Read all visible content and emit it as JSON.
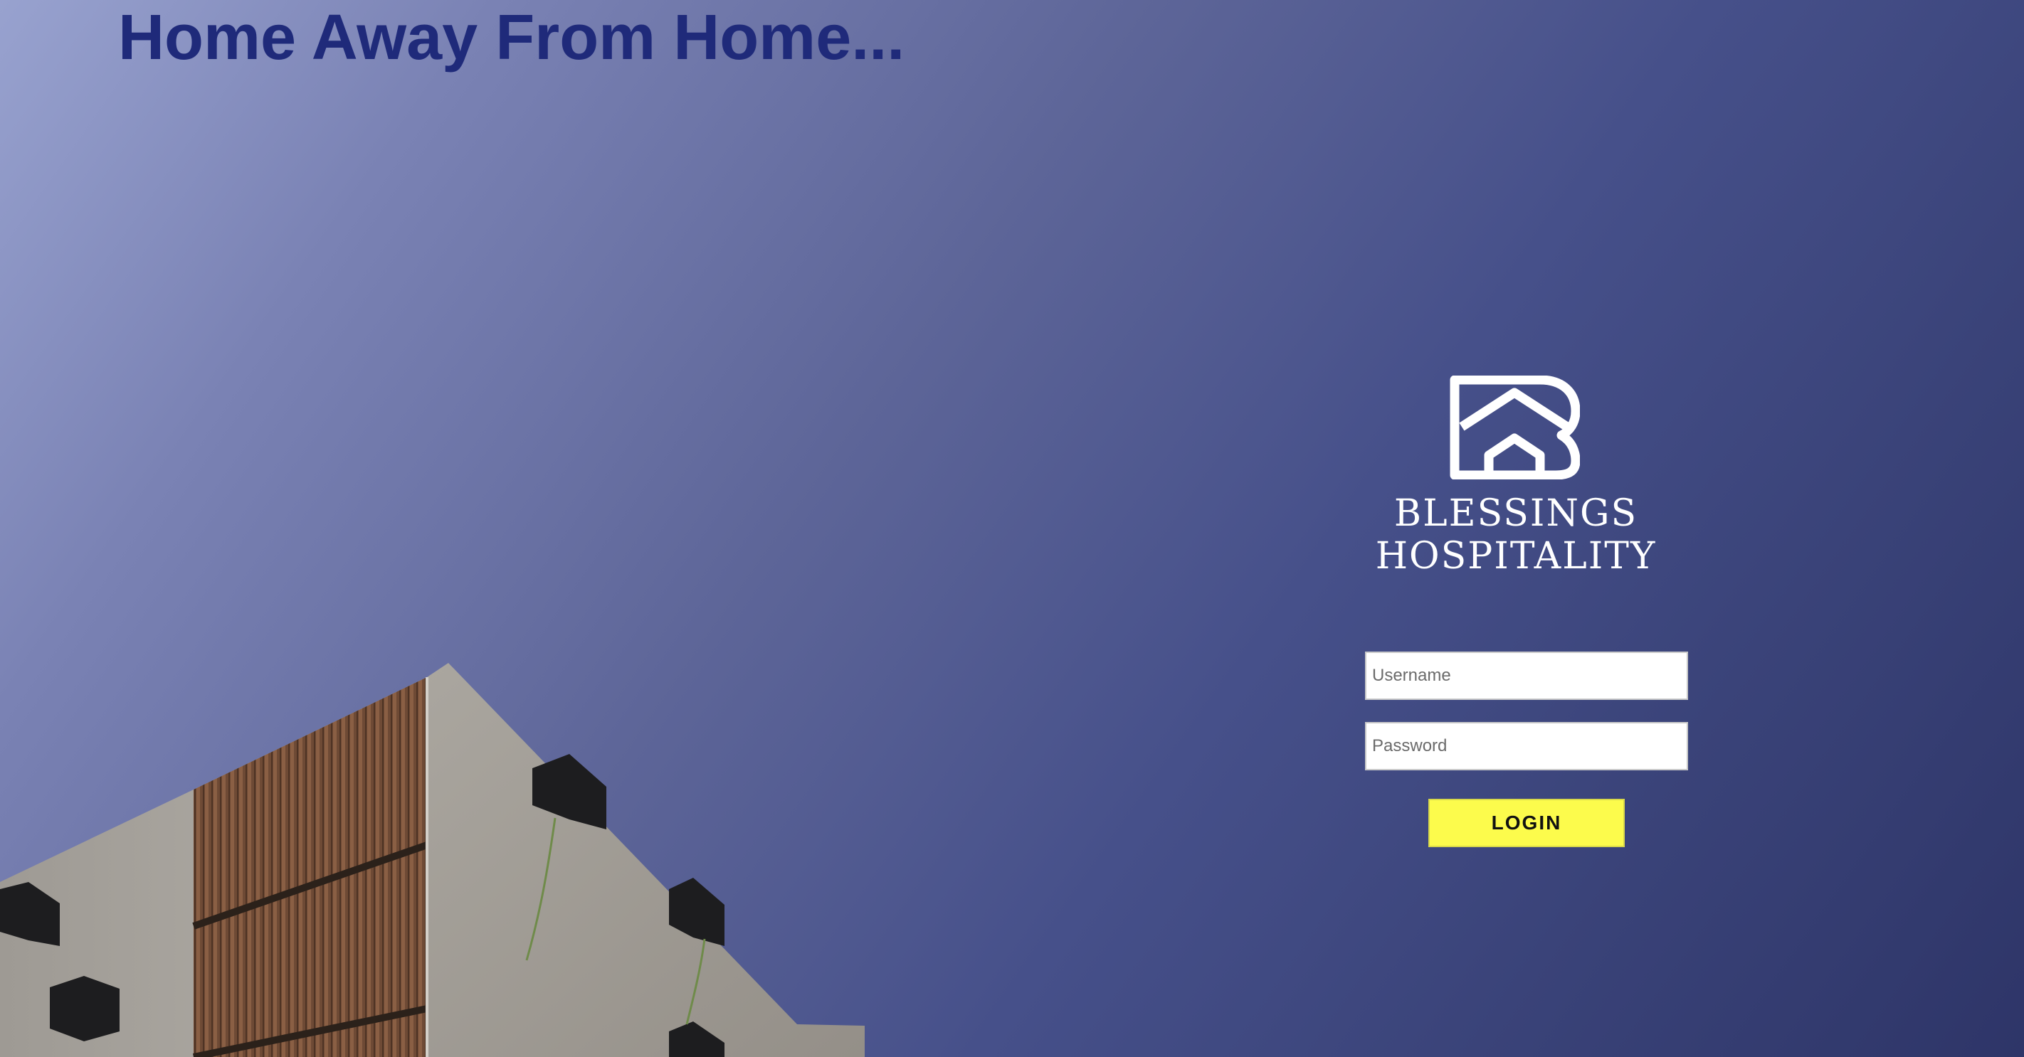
{
  "tagline": "Home Away From Home...",
  "brand": {
    "logo_icon": "house-b-logo-icon",
    "name_line1": "BLESSINGS",
    "name_line2": "HOSPITALITY"
  },
  "login_form": {
    "username_placeholder": "Username",
    "username_value": "",
    "password_placeholder": "Password",
    "password_value": "",
    "login_label": "LOGIN"
  },
  "colors": {
    "tagline": "#1f2a7a",
    "login_button": "#fcfb4c",
    "background_start": "#98a2cf",
    "background_end": "#2e3568"
  }
}
